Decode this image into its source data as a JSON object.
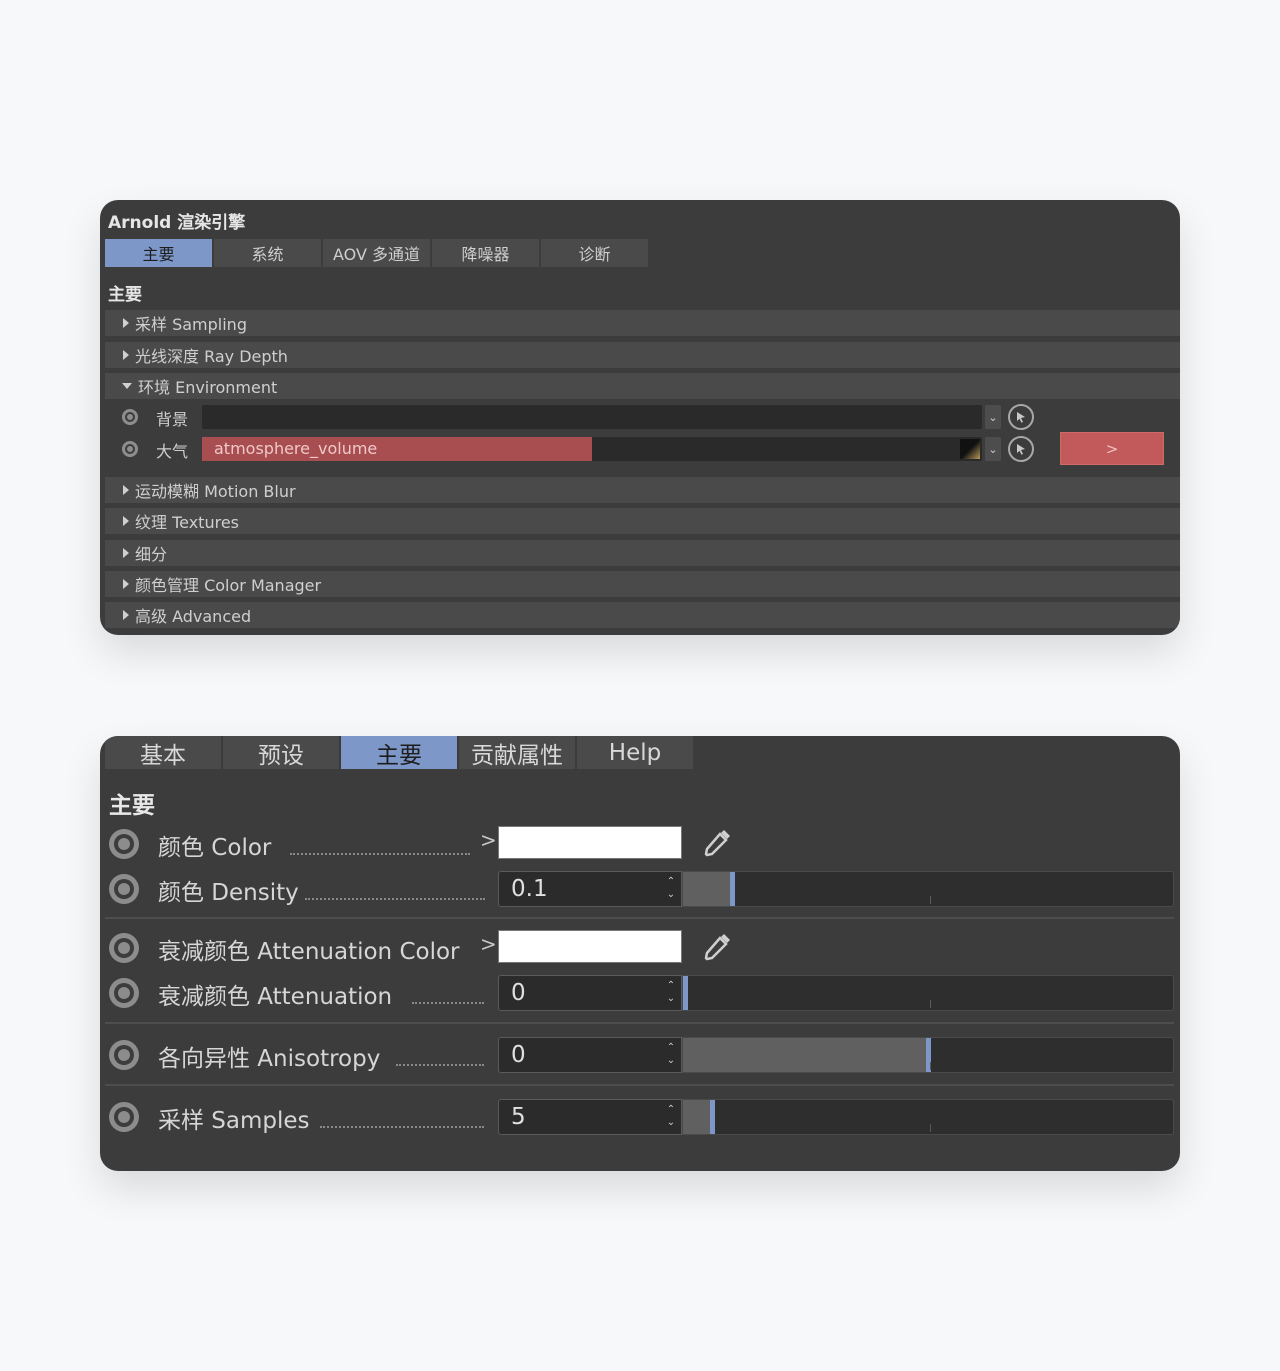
{
  "render_panel": {
    "title": "Arnold 渲染引擎",
    "tabs": [
      {
        "label": "主要",
        "active": true
      },
      {
        "label": "系统",
        "active": false
      },
      {
        "label": "AOV 多通道",
        "active": false
      },
      {
        "label": "降噪器",
        "active": false
      },
      {
        "label": "诊断",
        "active": false
      }
    ],
    "section": "主要",
    "groups_before": [
      {
        "label": "采样 Sampling"
      },
      {
        "label": "光线深度 Ray Depth"
      }
    ],
    "environment": {
      "label": "环境 Environment",
      "background_label": "背景",
      "atmosphere_label": "大气",
      "atmosphere_value": "atmosphere_volume",
      "dropdown_glyph": "⌄",
      "go_button": ">"
    },
    "groups_after": [
      {
        "label": "运动模糊 Motion Blur"
      },
      {
        "label": "纹理 Textures"
      },
      {
        "label": "细分"
      },
      {
        "label": "颜色管理 Color Manager"
      },
      {
        "label": "高级 Advanced"
      }
    ],
    "colors": {
      "accent": "#7d98c8",
      "link_red": "#a84e50"
    }
  },
  "volume_panel": {
    "tabs": [
      {
        "label": "基本",
        "active": false
      },
      {
        "label": "预设",
        "active": false
      },
      {
        "label": "主要",
        "active": true
      },
      {
        "label": "贡献属性",
        "active": false
      },
      {
        "label": "Help",
        "active": false
      }
    ],
    "section": "主要",
    "params": {
      "color": {
        "label": "颜色 Color",
        "chevron": ">",
        "swatch": "#ffffff"
      },
      "density": {
        "label": "颜色 Density",
        "value": "0.1",
        "slider_fraction": 0.1
      },
      "atten_color": {
        "label": "衰减颜色 Attenuation Color",
        "chevron": ">",
        "swatch": "#ffffff"
      },
      "attenuation": {
        "label": "衰减颜色 Attenuation",
        "value": "0",
        "slider_fraction": 0.0
      },
      "anisotropy": {
        "label": "各向异性 Anisotropy",
        "value": "0",
        "slider_fraction": 0.5
      },
      "samples": {
        "label": "采样 Samples",
        "value": "5",
        "slider_fraction": 0.06
      }
    },
    "spin_up": "⌃",
    "spin_down": "⌄"
  }
}
